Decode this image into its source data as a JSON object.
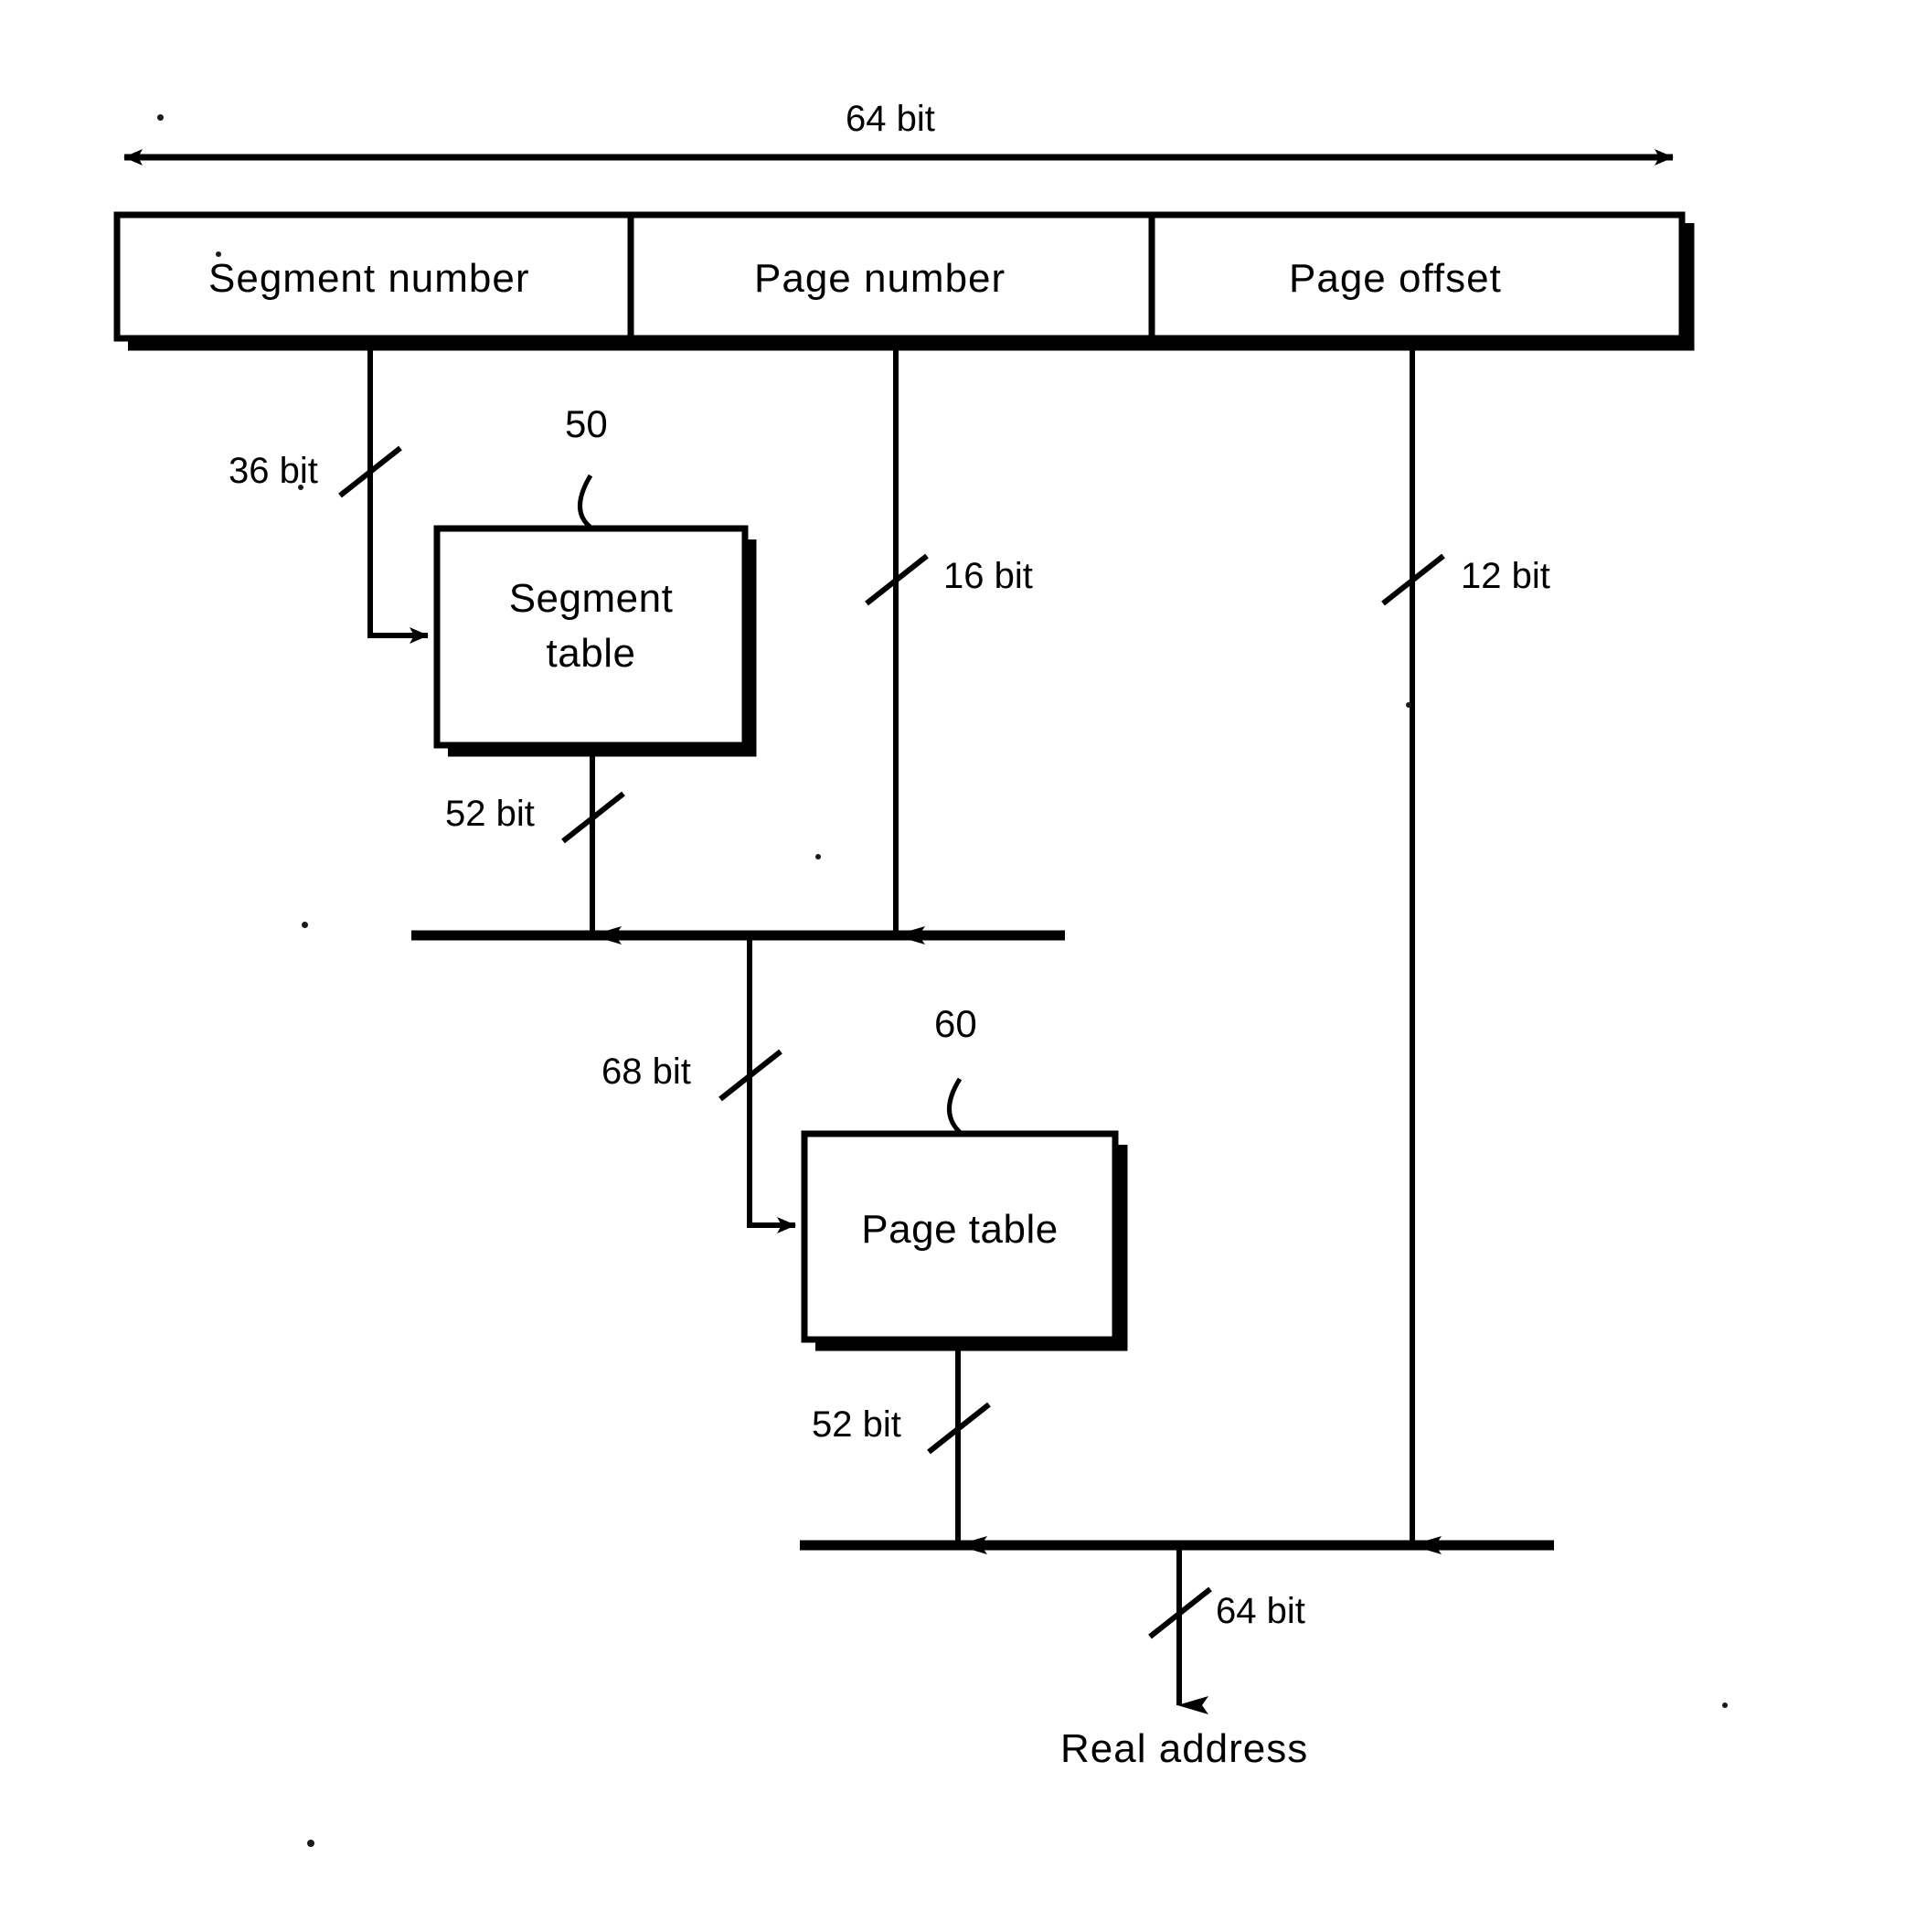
{
  "figure": {
    "title_dimension": "64 bit",
    "output_label": "Real address"
  },
  "address_bar": {
    "fields": [
      {
        "label": "Segment number",
        "width_label": "36 bit"
      },
      {
        "label": "Page number",
        "width_label": "16 bit"
      },
      {
        "label": "Page offset",
        "width_label": "12 bit"
      }
    ]
  },
  "blocks": [
    {
      "id": "segment-table",
      "label_line1": "Segment",
      "label_line2": "table",
      "ref_number": "50"
    },
    {
      "id": "page-table",
      "label_line1": "Page table",
      "label_line2": "",
      "ref_number": "60"
    }
  ],
  "bit_widths": {
    "total": "64 bit",
    "segment_number": "36 bit",
    "page_number": "16 bit",
    "page_offset": "12 bit",
    "segment_table_out": "52 bit",
    "page_table_in": "68 bit",
    "page_table_out": "52 bit",
    "real_address": "64 bit"
  },
  "reference_numerals": {
    "segment_table": "50",
    "page_table": "60"
  },
  "colors": {
    "ink": "#000000",
    "background": "#ffffff"
  }
}
